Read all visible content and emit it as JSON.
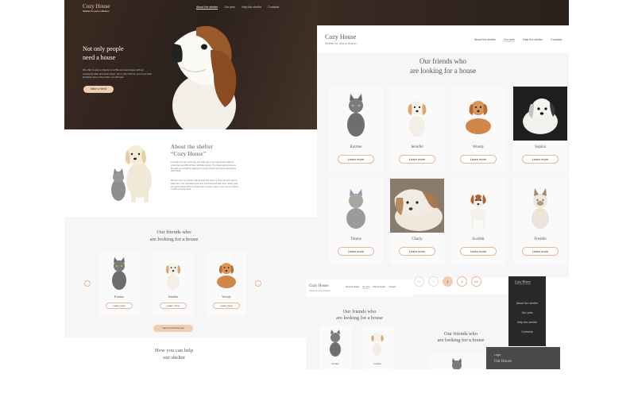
{
  "hero": {
    "logo": "Cozy House",
    "tagline": "Shelter for pets in Boston",
    "nav": [
      "About the shelter",
      "Our pets",
      "Help the shelter",
      "Contacts"
    ],
    "headline_1": "Not only people",
    "headline_2": "need a house",
    "text": "We offer to give a chance to a little and sad puppy with an extremely wide and open heart. He or she will love you more than anybody else in the world, you will see!",
    "cta": "Make a friend"
  },
  "about": {
    "title_1": "About the shelter",
    "title_2": "“Cozy House”",
    "p1": "Currently we have 121 dogs and 342 cats on our hands and statistics show that only 20% of them will find a family. The others will continue to live with us and will be waiting for a lucky chance to become someone's best friend.",
    "p2": "We have our own shelter with 24 pets that have no home and we want to help them. Our volunteers give them food and look after them. Every year we rescue about 25% of animals from streets. Help us give them a chance to have a loving home."
  },
  "friends_left": {
    "title_1": "Our friends who",
    "title_2": "are looking for a house",
    "pets": [
      "Katrine",
      "Jennifer",
      "Woody"
    ],
    "card_btn": "Learn more",
    "prev": "←",
    "next": "→",
    "cta": "Get to know the rest"
  },
  "help": {
    "title_1": "How you can help",
    "title_2": "our shelter"
  },
  "pets_page": {
    "logo": "Cozy House",
    "tagline": "Shelter for pets in Boston",
    "nav": [
      "About the shelter",
      "Our pets",
      "Help the shelter",
      "Contacts"
    ],
    "title_1": "Our friends who",
    "title_2": "are looking for a house",
    "row1": [
      "Katrine",
      "Jennifer",
      "Woody",
      "Sophia"
    ],
    "row2": [
      "Timmy",
      "Charly",
      "Scarlett",
      "Freddie"
    ],
    "card_btn": "Learn more",
    "pagination": [
      "<<",
      "<",
      "1",
      ">",
      ">>"
    ]
  },
  "mobile": {
    "logo": "Cozy House",
    "tagline": "Shelter for pets in Boston",
    "nav": [
      "About the shelter",
      "Our pets",
      "Help the shelter",
      "Contacts"
    ],
    "title_1": "Our friends who",
    "title_2": "are looking for a house",
    "pets": [
      "Katrine",
      "Jennifer"
    ]
  },
  "tablet": {
    "title_1": "Our friends who",
    "title_2": "are looking for a house"
  },
  "menu_dark": {
    "logo": "Cozy House",
    "tagline": "Shelter for pets in Boston",
    "items": [
      "About the shelter",
      "Our pets",
      "Help the shelter",
      "Contacts"
    ]
  },
  "menu_dark2": {
    "label": "Logo",
    "logo": "Our House"
  },
  "colors": {
    "accent": "#f1cdb3",
    "dark_bg": "#3a2c25",
    "page_bg": "#f6f6f6",
    "text": "#545454"
  }
}
